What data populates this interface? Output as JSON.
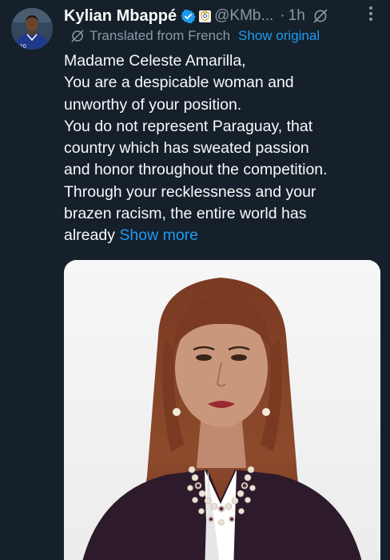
{
  "tweet": {
    "author_name": "Kylian Mbappé",
    "handle": "@KMb...",
    "separator": "·",
    "time": "1h",
    "translated_label": "Translated from French",
    "show_original": "Show original",
    "lines": [
      "Madame Celeste Amarilla,",
      "You are a despicable woman and",
      "unworthy of your position.",
      "You do not represent Paraguay, that",
      "country which has sweated passion",
      "and honor throughout the competition.",
      "Through your recklessness and your",
      "brazen racism, the entire world has"
    ],
    "last_line_start": "already",
    "show_more": "Show more",
    "avatar_jersey_number": "10"
  },
  "icons": {
    "verified": "verified-badge-icon",
    "affiliation": "club-crest-icon",
    "grok": "grok-icon",
    "more": "more-options-icon",
    "translate": "translate-icon"
  },
  "colors": {
    "background": "#15202b",
    "text": "#f7f9f9",
    "secondary": "#8b98a5",
    "accent": "#1d9bf0"
  }
}
